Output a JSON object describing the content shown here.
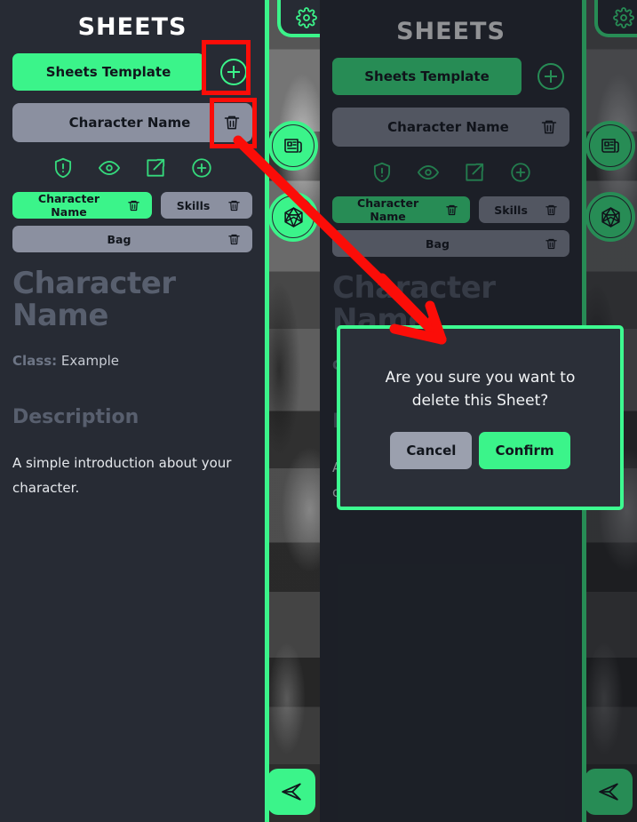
{
  "app": {
    "sheets_title": "SHEETS",
    "template_button": "Sheets Template",
    "add_sheet_icon": "plus-circle-icon",
    "sheet_name": "Character Name",
    "delete_sheet_icon": "trash-icon",
    "toolbar_icons": [
      {
        "name": "shield-alert-icon"
      },
      {
        "name": "eye-icon"
      },
      {
        "name": "external-link-icon"
      },
      {
        "name": "plus-circle-icon"
      }
    ],
    "tabs": [
      {
        "label": "Character Name",
        "active": true
      },
      {
        "label": "Skills",
        "active": false
      },
      {
        "label": "Bag",
        "active": false
      }
    ],
    "character": {
      "title_line1": "Character",
      "title_line2": "Name",
      "class_label": "Class:",
      "class_value": "Example",
      "description_heading": "Description",
      "description_text": "A simple introduction about your character."
    },
    "rail": {
      "settings_icon": "gear-icon",
      "news_icon": "news-article-icon",
      "dice_icon": "d20-dice-icon",
      "send_icon": "send-icon"
    }
  },
  "dialog": {
    "message": "Are you sure you want to delete this Sheet?",
    "cancel_label": "Cancel",
    "confirm_label": "Confirm"
  },
  "colors": {
    "accent_green": "#3bf48a",
    "dialog_border": "#3dfb90",
    "panel_bg": "#272b34",
    "row_gray": "#8b90a0",
    "annotation_red": "#fb0d08",
    "heading_gray": "#585f6e"
  }
}
